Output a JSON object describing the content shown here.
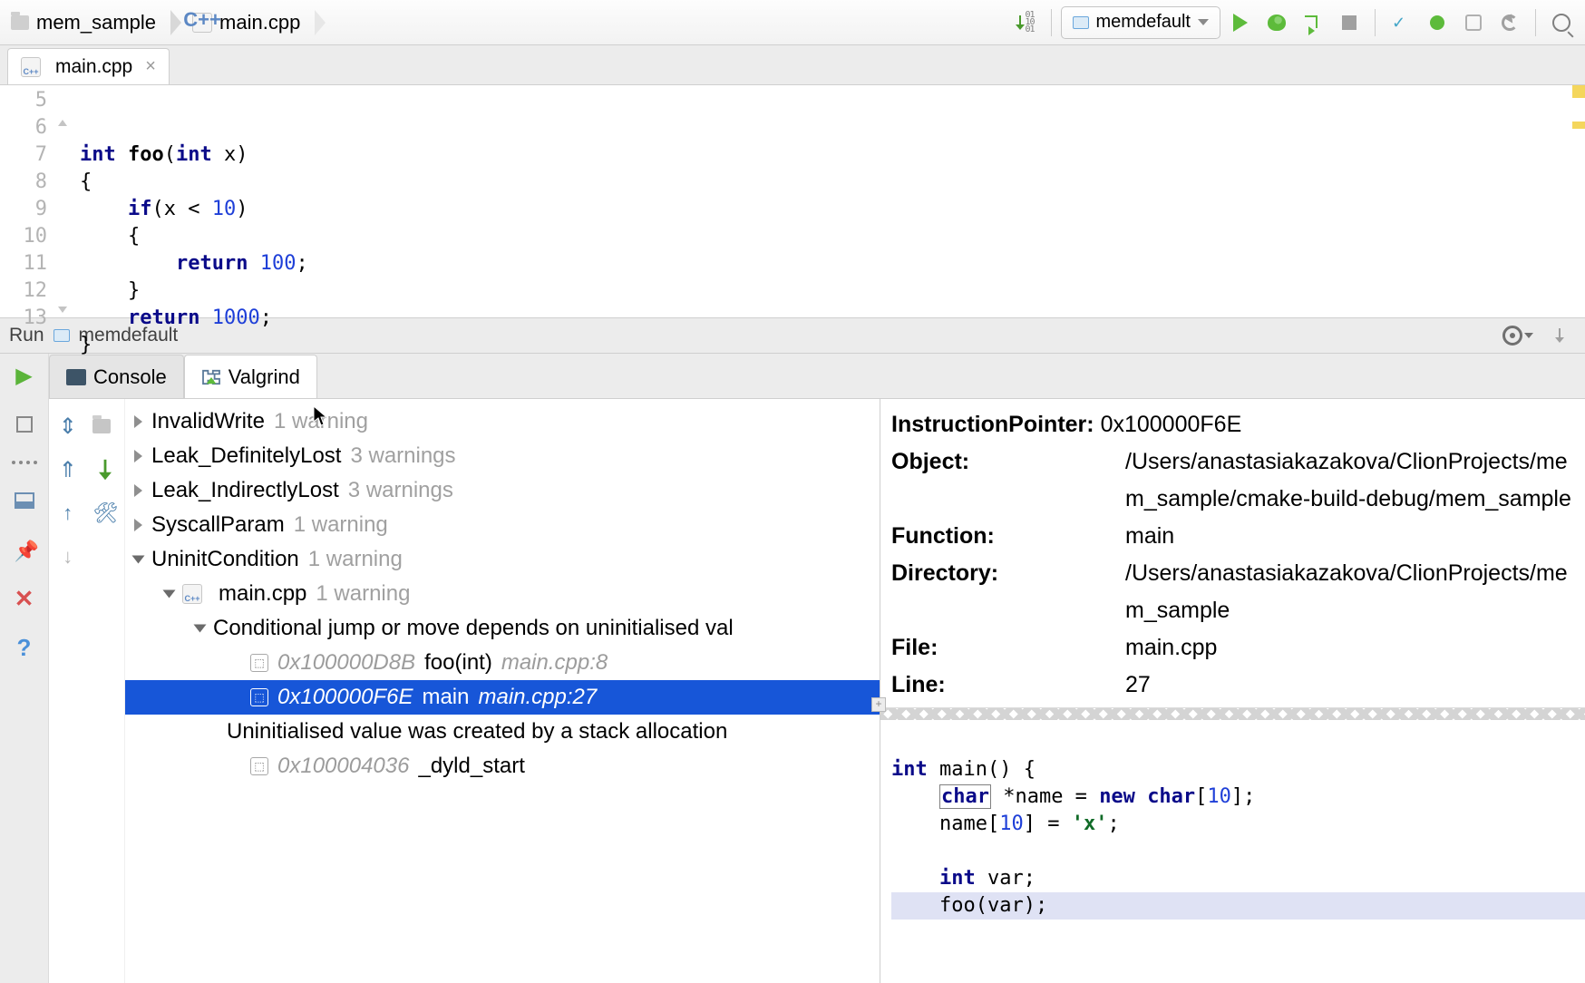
{
  "breadcrumb": {
    "project": "mem_sample",
    "file": "main.cpp"
  },
  "config_selector": "memdefault",
  "editor_tab": {
    "filename": "main.cpp"
  },
  "editor": {
    "first_line_no": 5,
    "lines": [
      "",
      "int foo(int x)",
      "{",
      "    if(x < 10)",
      "    {",
      "        return 100;",
      "    }",
      "    return 1000;",
      "}",
      ""
    ]
  },
  "run_panel": {
    "title": "Run",
    "config": "memdefault",
    "tabs": {
      "console": "Console",
      "valgrind": "Valgrind"
    }
  },
  "valgrind": {
    "categories": {
      "invalid_write": {
        "name": "InvalidWrite",
        "count": "1 warning"
      },
      "leak_def": {
        "name": "Leak_DefinitelyLost",
        "count": "3 warnings"
      },
      "leak_ind": {
        "name": "Leak_IndirectlyLost",
        "count": "3 warnings"
      },
      "syscall": {
        "name": "SyscallParam",
        "count": "1 warning"
      },
      "uninit": {
        "name": "UninitCondition",
        "count": "1 warning"
      }
    },
    "uninit_file": {
      "name": "main.cpp",
      "count": "1 warning"
    },
    "msg": "Conditional jump or move depends on uninitialised val",
    "frame0": {
      "addr": "0x100000D8B",
      "func": "foo(int)",
      "loc": "main.cpp:8"
    },
    "frame1": {
      "addr": "0x100000F6E",
      "func": "main",
      "loc": "main.cpp:27"
    },
    "submsg": "Uninitialised value was created by a stack allocation",
    "frame2": {
      "addr": "0x100004036",
      "func": "_dyld_start"
    }
  },
  "details": {
    "ip_label": "InstructionPointer:",
    "ip": "0x100000F6E",
    "object_label": "Object:",
    "object": "/Users/anastasiakazakova/ClionProjects/mem_sample/cmake-build-debug/mem_sample",
    "function_label": "Function:",
    "function": "main",
    "directory_label": "Directory:",
    "directory": "/Users/anastasiakazakova/ClionProjects/mem_sample",
    "file_label": "File:",
    "file": "main.cpp",
    "line_label": "Line:",
    "line": "27"
  },
  "snippet": {
    "l1a": "int",
    "l1b": " main() {",
    "l2a": "    ",
    "l2b": "char",
    "l2c": " *name = ",
    "l2d": "new",
    "l2e": " ",
    "l2f": "char",
    "l2g": "[",
    "l2h": "10",
    "l2i": "];",
    "l3a": "    name[",
    "l3b": "10",
    "l3c": "] = ",
    "l3d": "'x'",
    "l3e": ";",
    "l4": "",
    "l5a": "    ",
    "l5b": "int",
    "l5c": " var;",
    "l6": "    foo(var);"
  }
}
